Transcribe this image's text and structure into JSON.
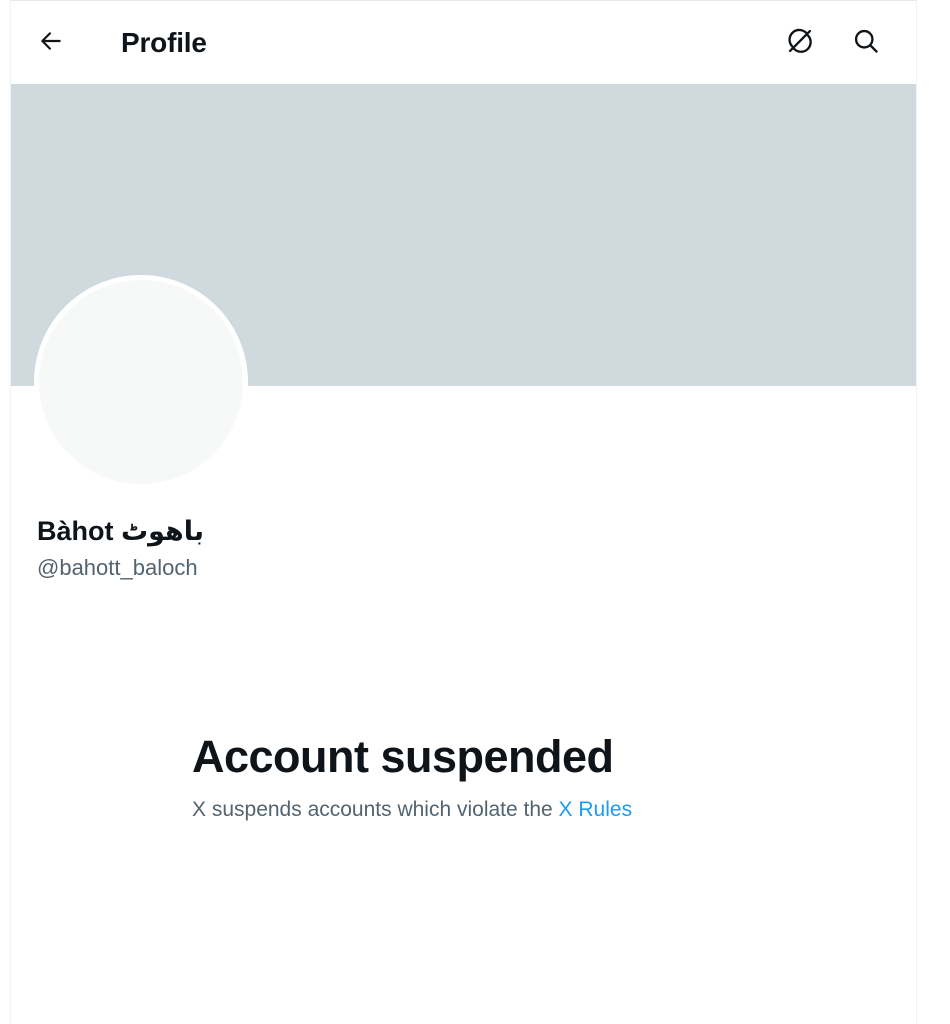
{
  "header": {
    "title": "Profile",
    "back_icon": "arrow-left-icon",
    "action_icons": [
      "grok-icon",
      "search-icon"
    ]
  },
  "profile": {
    "display_name": "Bàhot باھوٹ",
    "handle": "@bahott_baloch"
  },
  "suspension": {
    "title": "Account suspended",
    "message": "X suspends accounts which violate the ",
    "link_text": "X Rules"
  },
  "colors": {
    "banner": "#cfd9de",
    "avatar": "#f7f9f9",
    "link": "#1d9bf0",
    "secondary_text": "#536471"
  }
}
